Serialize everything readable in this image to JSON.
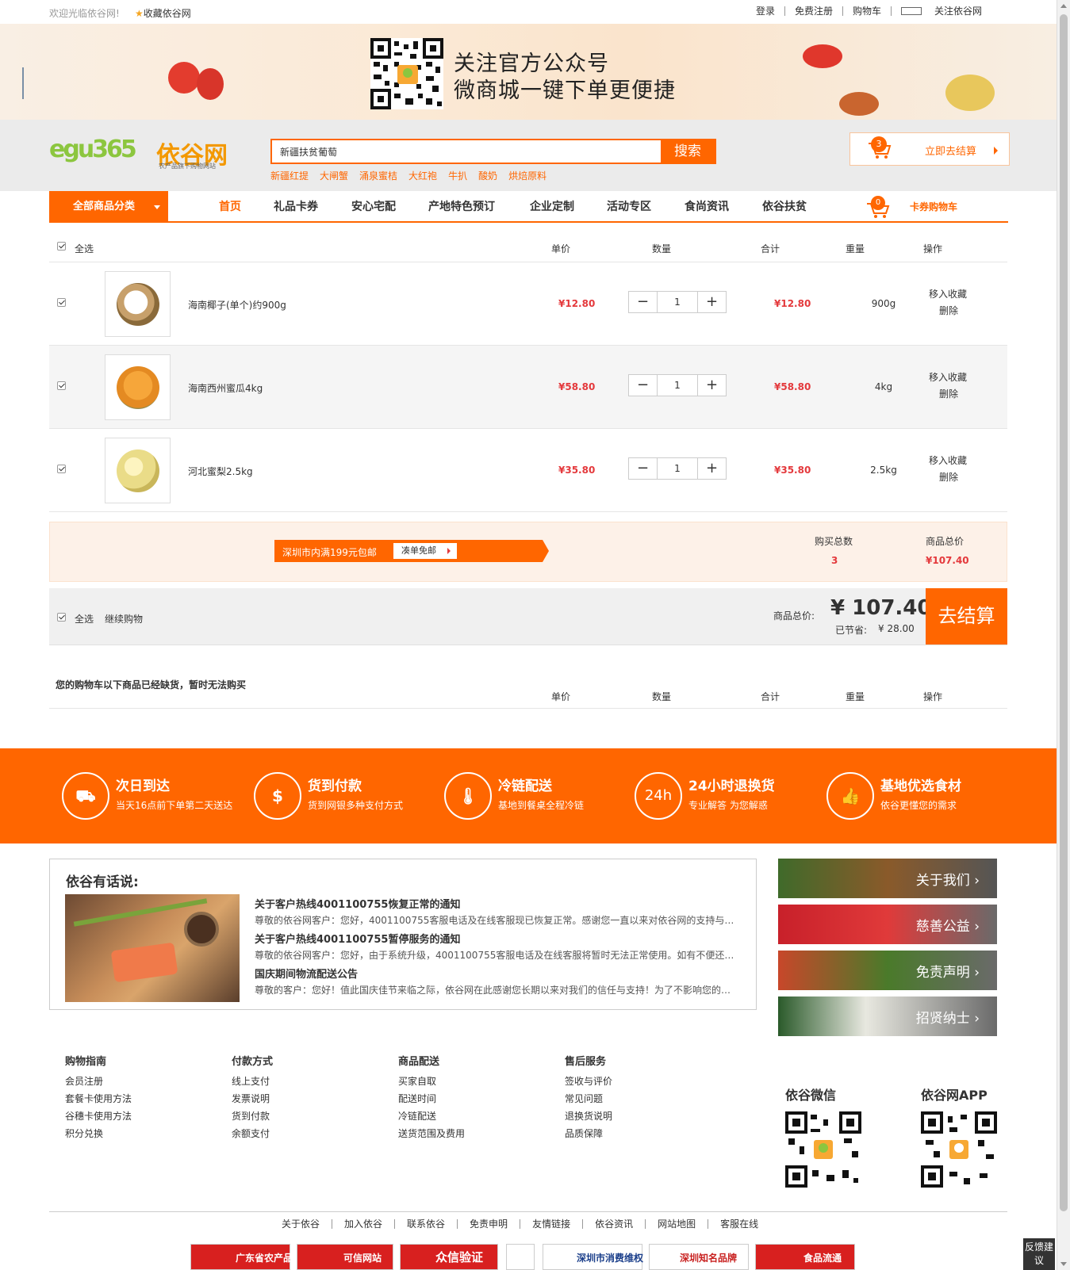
{
  "topbar": {
    "welcome": "欢迎光临依谷网!",
    "favorite": "收藏依谷网",
    "links": [
      "登录",
      "免费注册",
      "购物车",
      "关注依谷网"
    ]
  },
  "banner": {
    "line1": "关注官方公众号",
    "line2": "微商城一键下单更便捷"
  },
  "header": {
    "logo_text": "依谷网",
    "logo_sub": "农产品旗下购物网站",
    "search_value": "新疆扶贫葡萄",
    "search_button": "搜索",
    "hotwords": [
      "新疆红提",
      "大闸蟹",
      "涌泉蜜桔",
      "大红袍",
      "牛扒",
      "酸奶",
      "烘焙原料"
    ],
    "cart_count": "3",
    "cart_label": "立即去结算"
  },
  "nav": {
    "category": "全部商品分类",
    "items": [
      "首页",
      "礼品卡券",
      "安心宅配",
      "产地特色预订",
      "企业定制",
      "活动专区",
      "食尚资讯",
      "依谷扶贫"
    ],
    "card_cart_count": "0",
    "card_cart_label": "卡券购物车"
  },
  "cart": {
    "headers": {
      "select_all": "全选",
      "unit_price": "单价",
      "quantity": "数量",
      "subtotal": "合计",
      "weight": "重量",
      "action": "操作"
    },
    "items": [
      {
        "name": "海南椰子(单个)约900g",
        "price": "¥12.80",
        "qty": "1",
        "subtotal": "¥12.80",
        "weight": "900g",
        "fav": "移入收藏",
        "del": "删除"
      },
      {
        "name": "海南西州蜜瓜4kg",
        "price": "¥58.80",
        "qty": "1",
        "subtotal": "¥58.80",
        "weight": "4kg",
        "fav": "移入收藏",
        "del": "删除"
      },
      {
        "name": "河北蜜梨2.5kg",
        "price": "¥35.80",
        "qty": "1",
        "subtotal": "¥35.80",
        "weight": "2.5kg",
        "fav": "移入收藏",
        "del": "删除"
      }
    ],
    "qty_minus": "−",
    "qty_plus": "+"
  },
  "promo": {
    "ribbon": "深圳市内满199元包邮",
    "button": "凑单免邮",
    "count_label": "购买总数",
    "count_value": "3",
    "total_label": "商品总价",
    "total_value": "¥107.40"
  },
  "checkout": {
    "select_all": "全选",
    "continue": "继续购物",
    "total_label": "商品总价:",
    "total_value": "¥ 107.40",
    "saved_label": "已节省:",
    "saved_value": "¥ 28.00",
    "button": "去结算"
  },
  "out_of_stock": {
    "title": "您的购物车以下商品已经缺货，暂时无法购买",
    "headers": [
      "单价",
      "数量",
      "合计",
      "重量",
      "操作"
    ]
  },
  "features": [
    {
      "title": "次日到达",
      "sub": "当天16点前下单第二天送达",
      "icon": "truck-icon"
    },
    {
      "title": "货到付款",
      "sub": "货到网银多种支付方式",
      "icon": "wallet-icon"
    },
    {
      "title": "冷链配送",
      "sub": "基地到餐桌全程冷链",
      "icon": "thermometer-icon"
    },
    {
      "title": "24小时退换货",
      "sub": "专业解答 为您解惑",
      "icon": "24h-icon",
      "glyph": "24h"
    },
    {
      "title": "基地优选食材",
      "sub": "依谷更懂您的需求",
      "icon": "thumbs-up-icon"
    }
  ],
  "news": {
    "title": "依谷有话说:",
    "items": [
      {
        "title": "关于客户热线4001100755恢复正常的通知",
        "desc": "尊敬的依谷网客户：您好，4001100755客服电话及在线客服现已恢复正常。感谢您一直以来对依谷网的支持与默..."
      },
      {
        "title": "关于客户热线4001100755暂停服务的通知",
        "desc": "尊敬的依谷网客户：您好，由于系统升级，4001100755客服电话及在线客服将暂时无法正常使用。如有不便还请..."
      },
      {
        "title": "国庆期间物流配送公告",
        "desc": "尊敬的客户：您好！值此国庆佳节来临之际，依谷网在此感谢您长期以来对我们的信任与支持！为了不影响您的正..."
      }
    ]
  },
  "tiles": [
    "关于我们 ›",
    "慈善公益 ›",
    "免责声明 ›",
    "招贤纳士 ›"
  ],
  "footer": {
    "columns": [
      {
        "title": "购物指南",
        "links": [
          "会员注册",
          "套餐卡使用方法",
          "谷穗卡使用方法",
          "积分兑换"
        ]
      },
      {
        "title": "付款方式",
        "links": [
          "线上支付",
          "发票说明",
          "货到付款",
          "余额支付"
        ]
      },
      {
        "title": "商品配送",
        "links": [
          "买家自取",
          "配送时间",
          "冷链配送",
          "送货范围及费用"
        ]
      },
      {
        "title": "售后服务",
        "links": [
          "签收与评价",
          "常见问题",
          "退换货说明",
          "品质保障"
        ]
      }
    ],
    "qr_wechat": "依谷微信",
    "qr_app": "依谷网APP",
    "bottom_links": [
      "关于依谷",
      "加入依谷",
      "联系依谷",
      "免责申明",
      "友情链接",
      "依谷资讯",
      "网站地图",
      "客服在线"
    ],
    "badges": [
      "广东省农产品",
      "可信网站",
      "众信验证",
      "深圳市消费维权",
      "深圳知名品牌",
      "食品流通"
    ],
    "feedback": "反馈建议"
  },
  "colors": {
    "accent": "#ff6600",
    "price": "#e4393c"
  }
}
